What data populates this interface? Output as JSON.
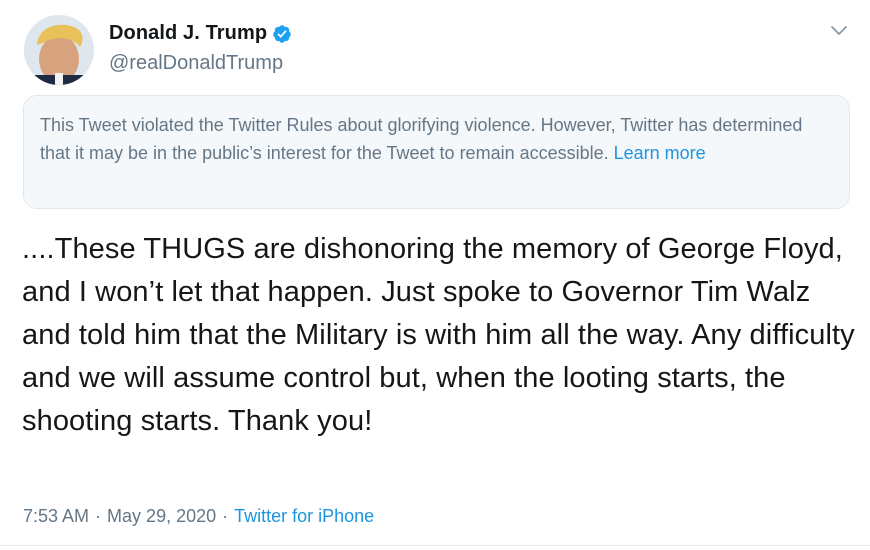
{
  "user": {
    "display_name": "Donald J. Trump",
    "handle": "@realDonaldTrump",
    "verified": true
  },
  "notice": {
    "text": "This Tweet violated the Twitter Rules about glorifying violence. However, Twitter has determined that it may be in the public’s interest for the Tweet to remain accessible.",
    "link": "Learn more"
  },
  "tweet": {
    "text": "....These THUGS are dishonoring the memory of George Floyd, and I won’t let that happen. Just spoke to Governor Tim Walz and told him that the Military is with him all the way. Any difficulty and we will assume control but, when the looting starts, the shooting starts. Thank you!",
    "time": "7:53 AM",
    "date": "May 29, 2020",
    "separator": "·",
    "source": "Twitter for iPhone"
  },
  "icons": {
    "verified": "verified-badge-icon",
    "more": "chevron-down-icon"
  },
  "colors": {
    "accent": "#1b95e0",
    "secondary_text": "#657786",
    "notice_bg": "#f5f8fa"
  }
}
